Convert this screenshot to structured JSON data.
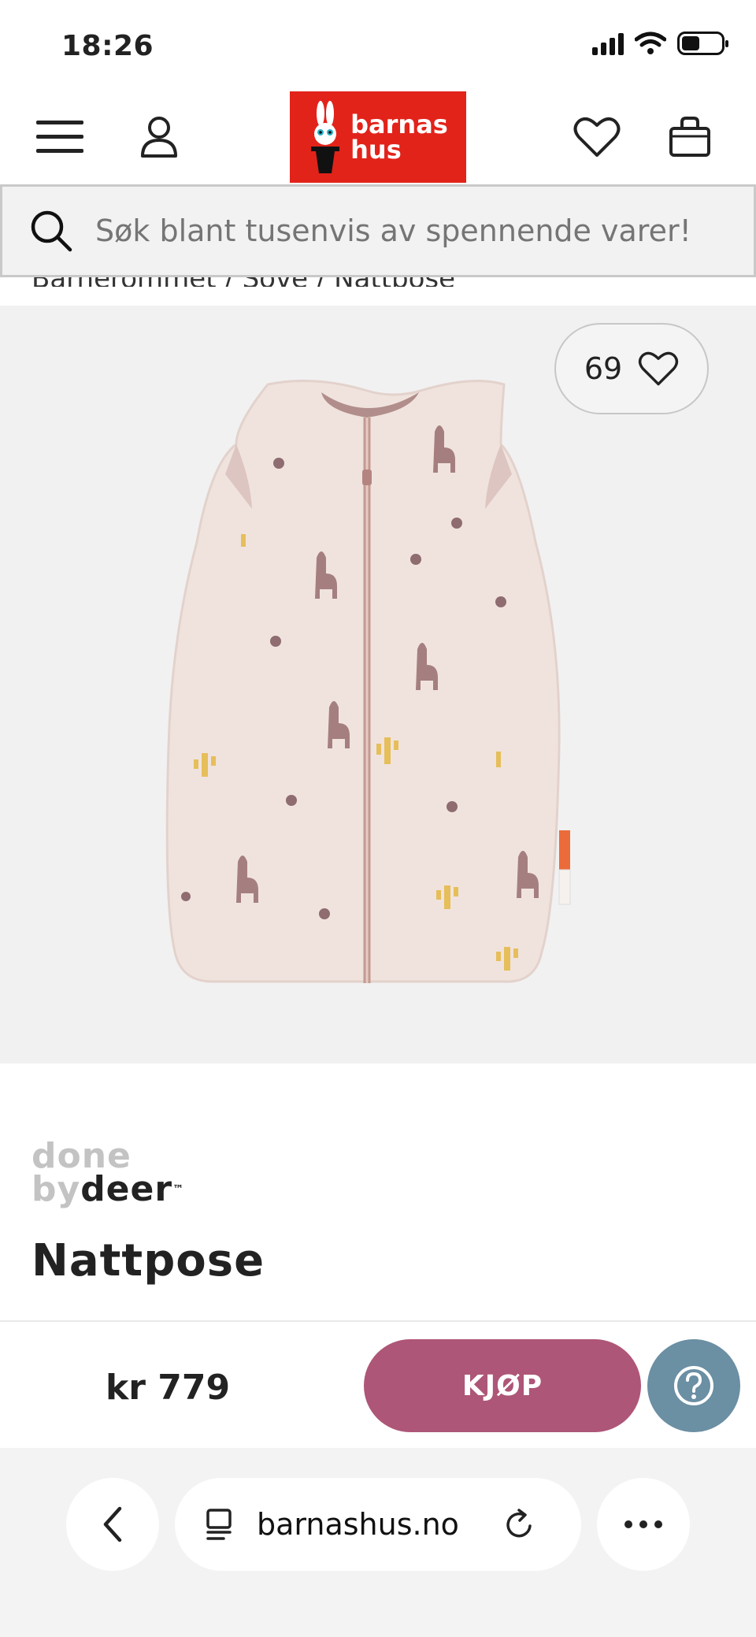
{
  "status_bar": {
    "time": "18:26"
  },
  "header": {
    "logo_line1": "barnas",
    "logo_line2": "hus",
    "icons": [
      "menu-icon",
      "user-icon",
      "heart-icon",
      "bag-icon"
    ]
  },
  "search": {
    "placeholder": "Søk blant tusenvis av spennende varer!"
  },
  "breadcrumb": {
    "items": [
      "Barnerommet",
      "Sove",
      "Nattpose"
    ],
    "text": "Barnerommet  /  Sove  /  Nattpose"
  },
  "product": {
    "like_count": "69",
    "brand_top": "done",
    "brand_by": "by",
    "brand_name": "deer",
    "brand_tm": "™",
    "title": "Nattpose",
    "price": "kr 779",
    "buy_label": "KJØP"
  },
  "browser": {
    "url": "barnashus.no"
  },
  "colors": {
    "brand_red": "#e2231a",
    "buy_button": "#ae5677",
    "help_button": "#6b8fa3",
    "product_bg": "#f1f1f1"
  }
}
